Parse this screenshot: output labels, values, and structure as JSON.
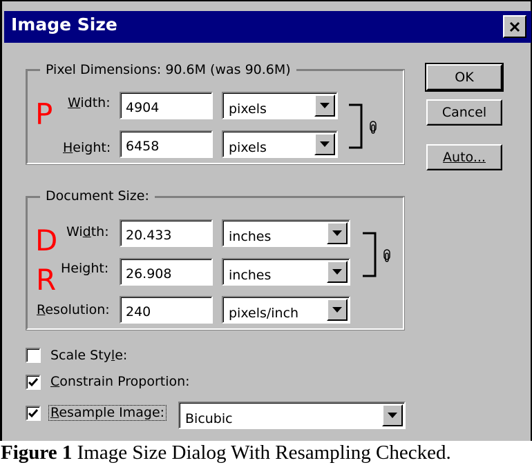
{
  "title": "Image Size",
  "pixel_dimensions": {
    "legend": "Pixel Dimensions:  90.6M (was 90.6M)",
    "marker": "P",
    "width": {
      "label_pre": "",
      "label_u": "W",
      "label_post": "idth:",
      "value": "4904",
      "unit": "pixels"
    },
    "height": {
      "label_pre": "",
      "label_u": "H",
      "label_post": "eight:",
      "value": "6458",
      "unit": "pixels"
    }
  },
  "document_size": {
    "legend": "Document Size:",
    "marker_d": "D",
    "marker_r": "R",
    "width": {
      "label_pre": "Wi",
      "label_u": "d",
      "label_post": "th:",
      "value": "20.433",
      "unit": "inches"
    },
    "height": {
      "label_pre": "Hei",
      "label_u": "g",
      "label_post": "ht:",
      "value": "26.908",
      "unit": "inches"
    },
    "resolution": {
      "label_pre": "",
      "label_u": "R",
      "label_post": "esolution:",
      "value": "240",
      "unit": "pixels/inch"
    }
  },
  "options": {
    "scale_styles": {
      "pre": "Scale Sty",
      "u": "l",
      "post": "e:",
      "checked": false
    },
    "constrain": {
      "pre": "",
      "u": "C",
      "post": "onstrain Proportion:",
      "checked": true
    },
    "resample": {
      "pre": "",
      "u": "R",
      "post": "esample Image:",
      "checked": true,
      "method": "Bicubic"
    }
  },
  "buttons": {
    "ok": "OK",
    "cancel": "Cancel",
    "auto_u": "A",
    "auto_rest": "uto..."
  },
  "caption": {
    "bold": "Figure 1",
    "text": " Image Size Dialog With Resampling Checked."
  }
}
